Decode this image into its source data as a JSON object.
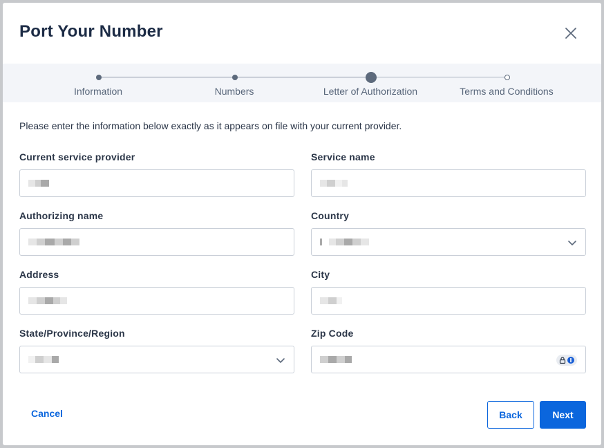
{
  "dialog": {
    "title": "Port Your Number",
    "close_icon": "close-icon"
  },
  "stepper": {
    "steps": [
      {
        "label": "Information",
        "state": "completed"
      },
      {
        "label": "Numbers",
        "state": "completed"
      },
      {
        "label": "Letter of Authorization",
        "state": "current"
      },
      {
        "label": "Terms and Conditions",
        "state": "upcoming"
      }
    ]
  },
  "form": {
    "intro": "Please enter the information below exactly as it appears on file with your current provider.",
    "fields": {
      "current_provider": {
        "label": "Current service provider",
        "value": "(redacted)"
      },
      "service_name": {
        "label": "Service name",
        "value": "(redacted)"
      },
      "authorizing_name": {
        "label": "Authorizing name",
        "value": "(redacted)"
      },
      "country": {
        "label": "Country",
        "value": "(redacted)",
        "type": "select"
      },
      "address": {
        "label": "Address",
        "value": "(redacted)"
      },
      "city": {
        "label": "City",
        "value": "(redacted)"
      },
      "state": {
        "label": "State/Province/Region",
        "value": "(redacted)",
        "type": "select"
      },
      "zip": {
        "label": "Zip Code",
        "value": "(redacted)",
        "icon": "password-manager-icon"
      }
    }
  },
  "actions": {
    "cancel": "Cancel",
    "back": "Back",
    "next": "Next"
  },
  "colors": {
    "primary": "#0b66dd",
    "title": "#1c2b45",
    "stepper_bg": "#f3f5f9"
  }
}
